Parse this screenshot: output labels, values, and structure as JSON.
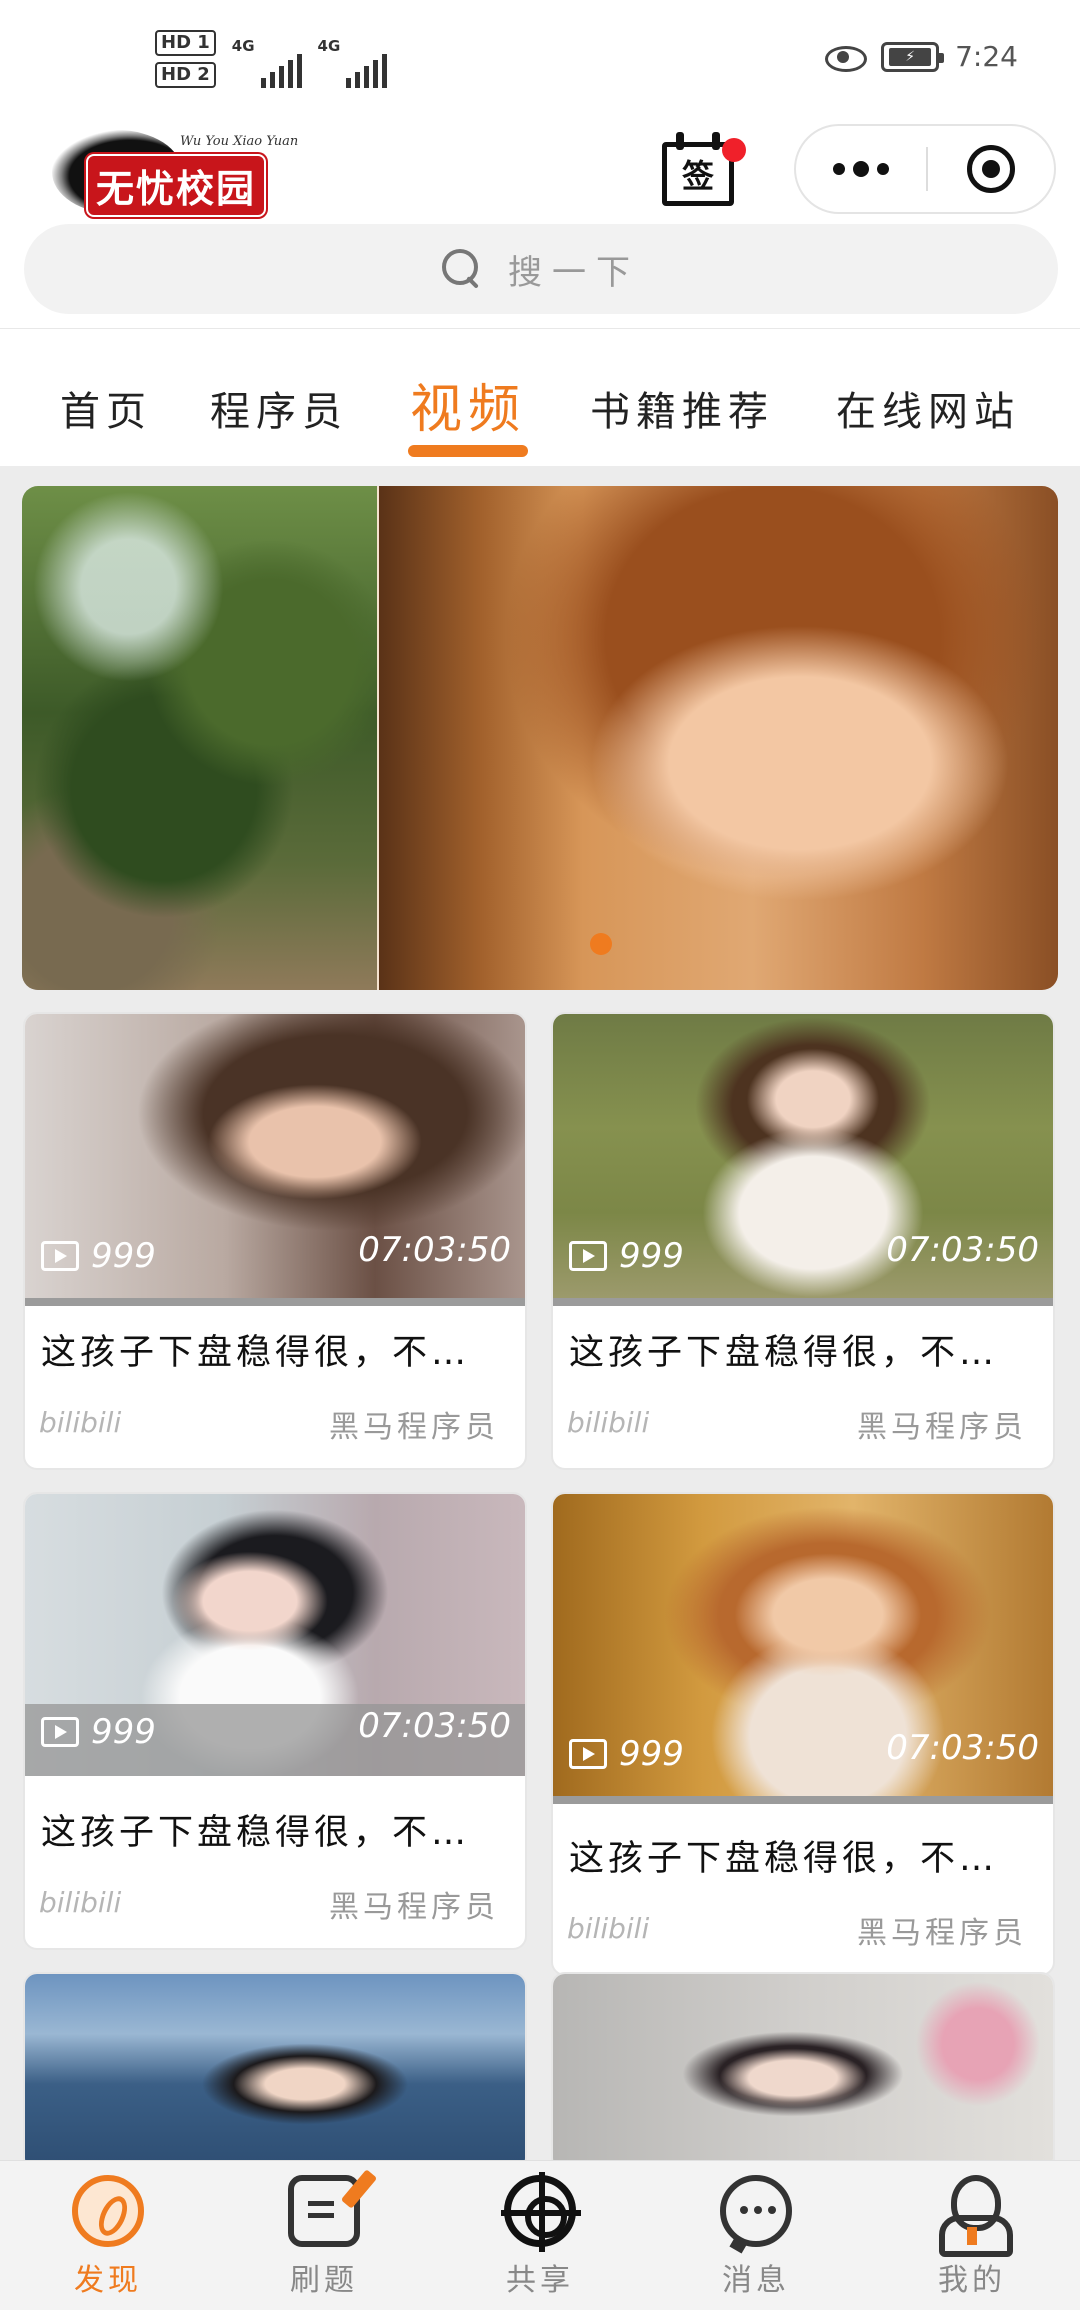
{
  "status_bar": {
    "sim1_label": "HD 1",
    "sim2_label": "HD 2",
    "net1": "4G",
    "net2": "4G",
    "time": "7:24"
  },
  "header": {
    "logo_text": "无忧校园",
    "logo_subtext": "Wu You Xiao Yuan",
    "signin_label": "签"
  },
  "search": {
    "placeholder": "搜一下"
  },
  "tabs": [
    {
      "label": "首页"
    },
    {
      "label": "程序员"
    },
    {
      "label": "视频",
      "active": true
    },
    {
      "label": "书籍推荐"
    },
    {
      "label": "在线网站"
    }
  ],
  "banner": {
    "slide_count": 1,
    "active_index": 0
  },
  "videos": [
    {
      "views": "999",
      "duration": "07:03:50",
      "title": "这孩子下盘稳得很，不…",
      "source": "bilibili",
      "author": "黑马程序员"
    },
    {
      "views": "999",
      "duration": "07:03:50",
      "title": "这孩子下盘稳得很，不…",
      "source": "bilibili",
      "author": "黑马程序员"
    },
    {
      "views": "999",
      "duration": "07:03:50",
      "title": "这孩子下盘稳得很，不…",
      "source": "bilibili",
      "author": "黑马程序员"
    },
    {
      "views": "999",
      "duration": "07:03:50",
      "title": "这孩子下盘稳得很，不…",
      "source": "bilibili",
      "author": "黑马程序员"
    }
  ],
  "bottom_nav": [
    {
      "label": "发现",
      "icon": "compass-icon",
      "active": true
    },
    {
      "label": "刷题",
      "icon": "edit-icon"
    },
    {
      "label": "共享",
      "icon": "target-icon"
    },
    {
      "label": "消息",
      "icon": "chat-icon"
    },
    {
      "label": "我的",
      "icon": "user-icon"
    }
  ],
  "colors": {
    "accent": "#ef7b1f",
    "badge": "#f0202a",
    "logo_red": "#c8151b"
  }
}
